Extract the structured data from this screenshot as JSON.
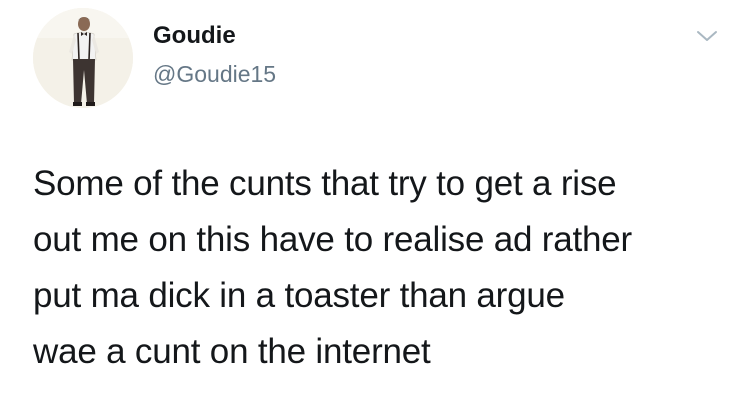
{
  "author": {
    "display_name": "Goudie",
    "handle": "@Goudie15",
    "avatar_icon": "profile-photo-person-icon"
  },
  "tweet": {
    "lines": [
      "Some of the cunts that try to get a rise",
      "out me on this have to realise ad rather",
      "put ma dick in a toaster than argue",
      "wae a cunt on the internet"
    ]
  },
  "menu": {
    "icon": "chevron-down-icon"
  },
  "colors": {
    "text": "#14171a",
    "secondary_text": "#657786",
    "background": "#ffffff",
    "caret": "#aab8c2"
  }
}
